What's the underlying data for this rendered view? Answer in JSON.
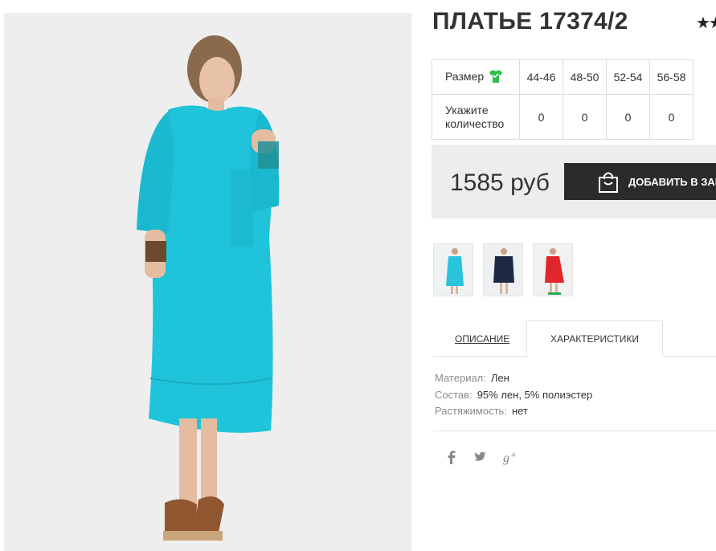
{
  "product": {
    "title": "ПЛАТЬЕ 17374/2",
    "rating_stars": "★★",
    "image_alt": "turquoise-dress-photo"
  },
  "size_table": {
    "size_label": "Размер",
    "qty_label_line1": "Укажите",
    "qty_label_line2": "количество",
    "sizes": [
      "44-46",
      "48-50",
      "52-54",
      "56-58"
    ],
    "quantities": [
      "0",
      "0",
      "0",
      "0"
    ]
  },
  "purchase": {
    "price": "1585 руб",
    "add_to_cart_label": "ДОБАВИТЬ В ЗАКАЗ"
  },
  "thumbnails": [
    {
      "name": "turquoise",
      "color": "#29c4dc"
    },
    {
      "name": "navy",
      "color": "#1e2a44"
    },
    {
      "name": "red",
      "color": "#e0262a"
    }
  ],
  "tabs": {
    "description": "ОПИСАНИЕ",
    "characteristics": "ХАРАКТЕРИСТИКИ"
  },
  "specs": [
    {
      "key": "Материал:",
      "value": "Лен"
    },
    {
      "key": "Состав:",
      "value": "95% лен, 5% полиэстер"
    },
    {
      "key": "Растяжимость:",
      "value": "нет"
    }
  ],
  "social": {
    "facebook": "f",
    "twitter": "twitter-bird",
    "googleplus": "g+"
  },
  "colors": {
    "dress": "#1fc4da",
    "button_bg": "#2b2b2b",
    "buy_box_bg": "#ededed",
    "size_icon": "#2fbf4b"
  }
}
